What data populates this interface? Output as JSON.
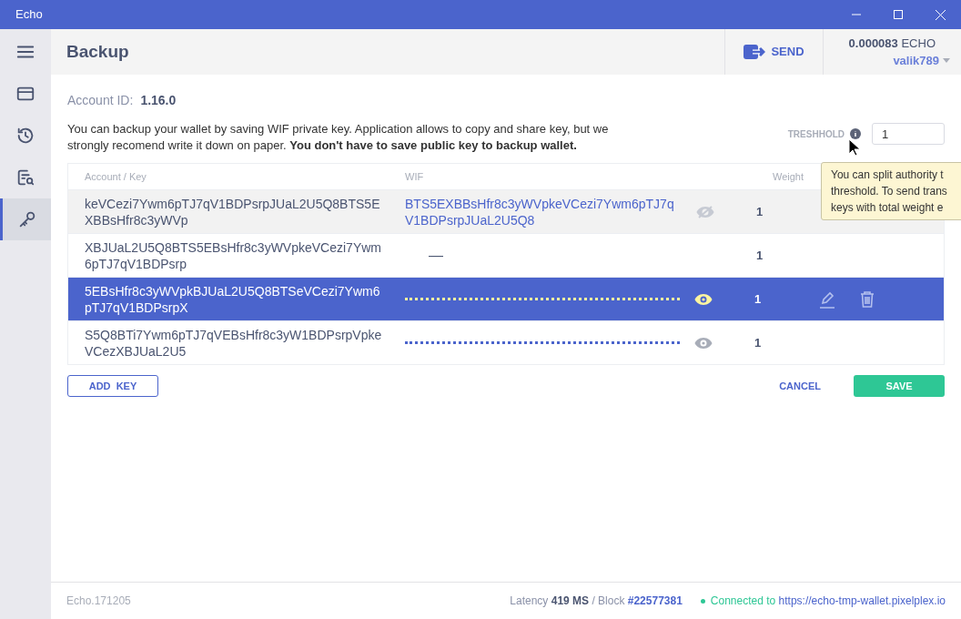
{
  "window": {
    "title": "Echo"
  },
  "sidebar": {
    "items": [
      {
        "selected": false
      },
      {
        "selected": false
      },
      {
        "selected": false
      },
      {
        "selected": false
      },
      {
        "selected": true
      }
    ]
  },
  "header": {
    "title": "Backup",
    "send": "SEND",
    "balance_amount": "0.000083",
    "balance_currency": "ECHO",
    "account": "valik789"
  },
  "account_id": {
    "label": "Account ID:",
    "value": "1.16.0"
  },
  "description": "You can backup your wallet by saving WIF private key. Application allows to copy and share key, but we strongly recomend write it down on paper.  **You don't have to save public key to backup wallet.**",
  "threshold": {
    "label": "TRESHHOLD",
    "value": "1"
  },
  "tooltip": {
    "lines": [
      "You can split authority t",
      "threshold. To send trans",
      "keys with total weight e"
    ]
  },
  "table": {
    "columns": [
      "Account / Key",
      "WIF",
      "Weight"
    ],
    "rows": [
      {
        "key": "keVCezi7Ywm6pTJ7qV1BDPsrpJUaL2U5Q8BTS5EXBBsHfr8c3yWVp",
        "wif": "BTS5EXBBsHfr8c3yWVpkeVCezi7Ywm6pTJ7qV1BDPsrpJUaL2U5Q8",
        "kind": "shown",
        "weight": "1",
        "selected": false,
        "hovered": true
      },
      {
        "key": "XBJUaL2U5Q8BTS5EBsHfr8c3yWVpkeVCezi7Ywm6pTJ7qV1BDPsrp",
        "wif": "—",
        "kind": "empty",
        "weight": "1",
        "selected": false,
        "hovered": false
      },
      {
        "key": "5EBsHfr8c3yWVpkBJUaL2U5Q8BTSeVCezi7Ywm6pTJ7qV1BDPsrpX",
        "kind": "hidden",
        "weight": "1",
        "selected": true,
        "hovered": false
      },
      {
        "key": "S5Q8BTi7Ywm6pTJ7qVEBsHfr8c3yW1BDPsrpVpkeVCezXBJUaL2U5",
        "kind": "hidden",
        "weight": "1",
        "selected": false,
        "hovered": false
      }
    ]
  },
  "actions": {
    "add": "ADD  KEY",
    "cancel": "CANCEL",
    "save": "SAVE"
  },
  "status_bar": {
    "version": "Echo.171205",
    "latency_label": "Latency",
    "latency_value": "419 MS",
    "block_label": "/ Block",
    "block_value": "#22577381",
    "connected_label": "Connected to",
    "connected_url": "https://echo-tmp-wallet.pixelplex.io"
  }
}
